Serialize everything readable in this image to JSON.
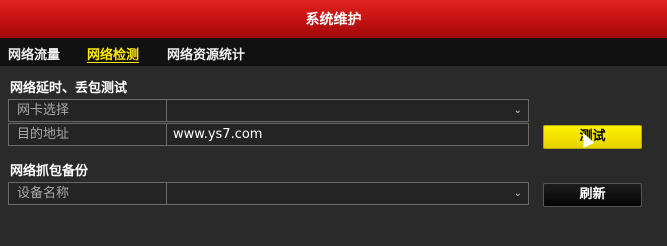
{
  "window": {
    "title": "系统维护"
  },
  "tabs": [
    {
      "label": "网络流量"
    },
    {
      "label": "网络检测"
    },
    {
      "label": "网络资源统计"
    }
  ],
  "sections": {
    "latency": {
      "title": "网络延时、丢包测试",
      "nic_label": "网卡选择",
      "nic_value": "",
      "dest_label": "目的地址",
      "dest_value": "www.ys7.com",
      "test_button": "测试"
    },
    "capture": {
      "title": "网络抓包备份",
      "device_label": "设备名称",
      "device_value": "",
      "refresh_button": "刷新"
    }
  },
  "colors": {
    "titlebar": "#c21010",
    "active_tab": "#ffe900",
    "primary_button": "#fff200"
  }
}
